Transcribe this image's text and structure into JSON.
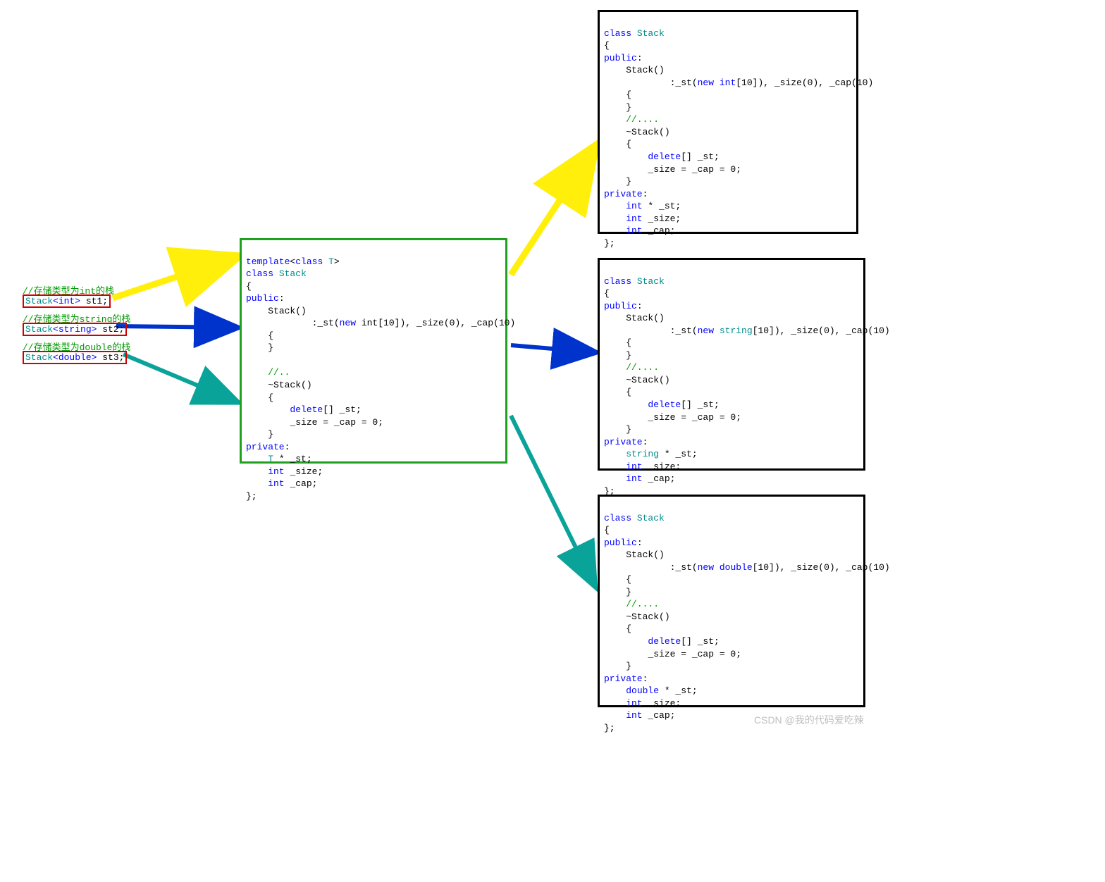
{
  "left": {
    "c1": "//存储类型为int的栈",
    "l1_stack": "Stack",
    "l1_tpl": "<int>",
    "l1_var": " st1;",
    "c2": "//存储类型为string的栈",
    "l2_stack": "Stack",
    "l2_tpl": "<string>",
    "l2_var": " st2;",
    "c3": "//存储类型为double的栈",
    "l3_stack": "Stack",
    "l3_tpl": "<double>",
    "l3_var": " st3;"
  },
  "center": {
    "tpl_kw": "template",
    "tpl_open": "<",
    "class_kw": "class",
    "tparam": "T",
    "tpl_close": ">",
    "class_kw2": "class",
    "cls": "Stack",
    "ob": "{",
    "public": "public",
    "colon": ":",
    "ctor": "Stack()",
    "init_pre": "            :_st(",
    "new": "new",
    "init_mid": " int[10]), _size(0), _cap(10)",
    "ob2": "    {",
    "cb2": "    }",
    "dots": "    //..",
    "dtor": "    ~Stack()",
    "ob3": "    {",
    "del": "        delete",
    "del_suffix": "[] _st;",
    "zero": "        _size = _cap = 0;",
    "cb3": "    }",
    "private": "private",
    "mtype": "    T",
    "mst": " * _st;",
    "int1": "    int",
    "msz": " _size;",
    "int2": "    int",
    "mcap": " _cap;",
    "cb": "};"
  },
  "right_int": {
    "type_name": "int",
    "ctor_type": "int"
  },
  "right_string": {
    "type_name": "string",
    "ctor_type": "string"
  },
  "right_double": {
    "type_name": "double",
    "ctor_type": "double"
  },
  "box_labels": {
    "class_kw": "class",
    "cls": "Stack",
    "ob": "{",
    "public": "public",
    "colon": ":",
    "ctor": "    Stack()",
    "init_pre": "            :_st(",
    "new": "new",
    "init_mid_a": " ",
    "init_mid_b": "[10]), _size(0), _cap(10)",
    "ob2": "    {",
    "cb2": "    }",
    "dots": "    //....",
    "dtor": "    ~Stack()",
    "ob3": "    {",
    "del": "        delete",
    "del_suffix": "[] _st;",
    "zero": "        _size = _cap = 0;",
    "cb3": "    }",
    "private": "private",
    "mtype_pre": "    ",
    "mst": " * _st;",
    "int1": "    int",
    "msz": " _size;",
    "int2": "    int",
    "mcap": " _cap;",
    "cb": "};"
  },
  "watermark": "CSDN @我的代码爱吃辣"
}
